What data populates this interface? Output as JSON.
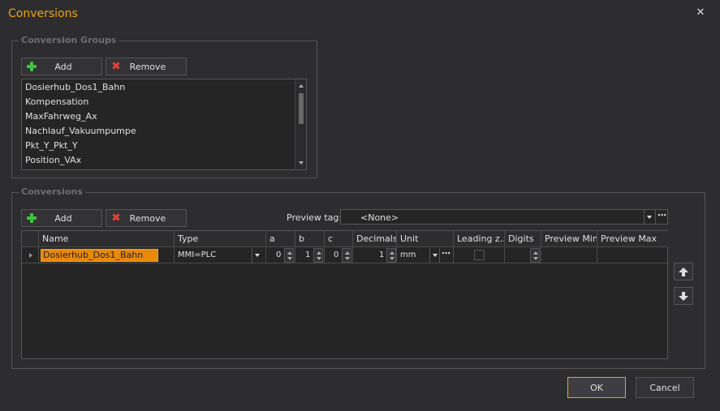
{
  "window": {
    "title": "Conversions"
  },
  "colors": {
    "accent": "#f0a30a",
    "background": "#2d2d30",
    "icon_add": "#3ec43e",
    "icon_remove": "#e34234"
  },
  "icons": {
    "close": "close-icon",
    "add": "plus-icon",
    "remove": "x-icon",
    "move_up": "arrow-up-icon",
    "move_down": "arrow-down-icon"
  },
  "groups_section": {
    "legend": "Conversion Groups",
    "add_label": "Add",
    "remove_label": "Remove",
    "items": [
      "Dosierhub_Dos1_Bahn",
      "Kompensation",
      "MaxFahrweg_Ax",
      "Nachlauf_Vakuumpumpe",
      "Pkt_Y_Pkt_Y",
      "Position_VAx"
    ]
  },
  "conversions_section": {
    "legend": "Conversions",
    "add_label": "Add",
    "remove_label": "Remove",
    "preview_tag_label": "Preview tag:",
    "preview_tag_value": "<None>",
    "columns": [
      "Name",
      "Type",
      "a",
      "b",
      "c",
      "Decimals",
      "Unit",
      "Leading z...",
      "Digits",
      "Preview Min",
      "Preview Max"
    ],
    "rows": [
      {
        "name": "Dosierhub_Dos1_Bahn",
        "type": "MMI=PLC",
        "a": "0",
        "b": "1",
        "c": "0",
        "decimals": "1",
        "unit": "mm",
        "leading_zeros": false,
        "digits": "",
        "preview_min": "",
        "preview_max": ""
      }
    ]
  },
  "footer": {
    "ok_label": "OK",
    "cancel_label": "Cancel"
  }
}
